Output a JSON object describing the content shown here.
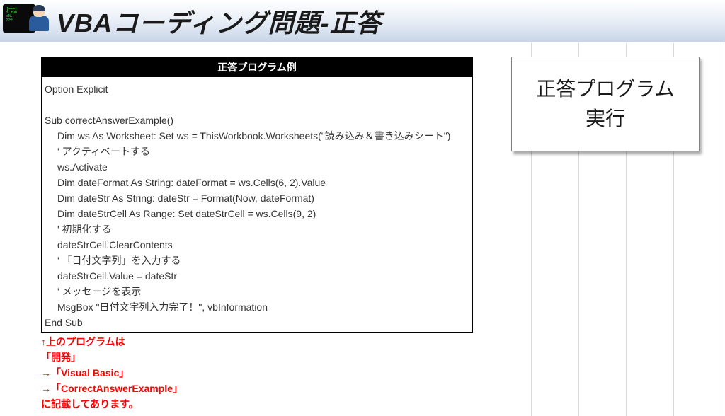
{
  "header": {
    "title": "VBAコーディング問題-正答"
  },
  "code_box": {
    "header": "正答プログラム例",
    "lines": [
      {
        "text": "Option Explicit",
        "indent": 0
      },
      {
        "text": "",
        "indent": 0
      },
      {
        "text": "Sub correctAnswerExample()",
        "indent": 0
      },
      {
        "text": "Dim ws As Worksheet: Set ws = ThisWorkbook.Worksheets(\"読み込み＆書き込みシート\")",
        "indent": 1
      },
      {
        "text": "' アクティベートする",
        "indent": 1
      },
      {
        "text": "ws.Activate",
        "indent": 1
      },
      {
        "text": "Dim dateFormat As String: dateFormat = ws.Cells(6, 2).Value",
        "indent": 1
      },
      {
        "text": "Dim dateStr As String: dateStr = Format(Now, dateFormat)",
        "indent": 1
      },
      {
        "text": "Dim dateStrCell As Range: Set dateStrCell = ws.Cells(9, 2)",
        "indent": 1
      },
      {
        "text": "' 初期化する",
        "indent": 1
      },
      {
        "text": "dateStrCell.ClearContents",
        "indent": 1
      },
      {
        "text": "' 「日付文字列」を入力する",
        "indent": 1
      },
      {
        "text": "dateStrCell.Value = dateStr",
        "indent": 1
      },
      {
        "text": "' メッセージを表示",
        "indent": 1
      },
      {
        "text": "MsgBox \"日付文字列入力完了！\", vbInformation",
        "indent": 1
      },
      {
        "text": "End Sub",
        "indent": 0
      }
    ]
  },
  "note_lines": [
    "↑上のプログラムは",
    "「開発」",
    "→「Visual Basic」",
    "→「CorrectAnswerExample」",
    "に記載してあります。"
  ],
  "run_button": {
    "line1": "正答プログラム",
    "line2": "実行"
  }
}
